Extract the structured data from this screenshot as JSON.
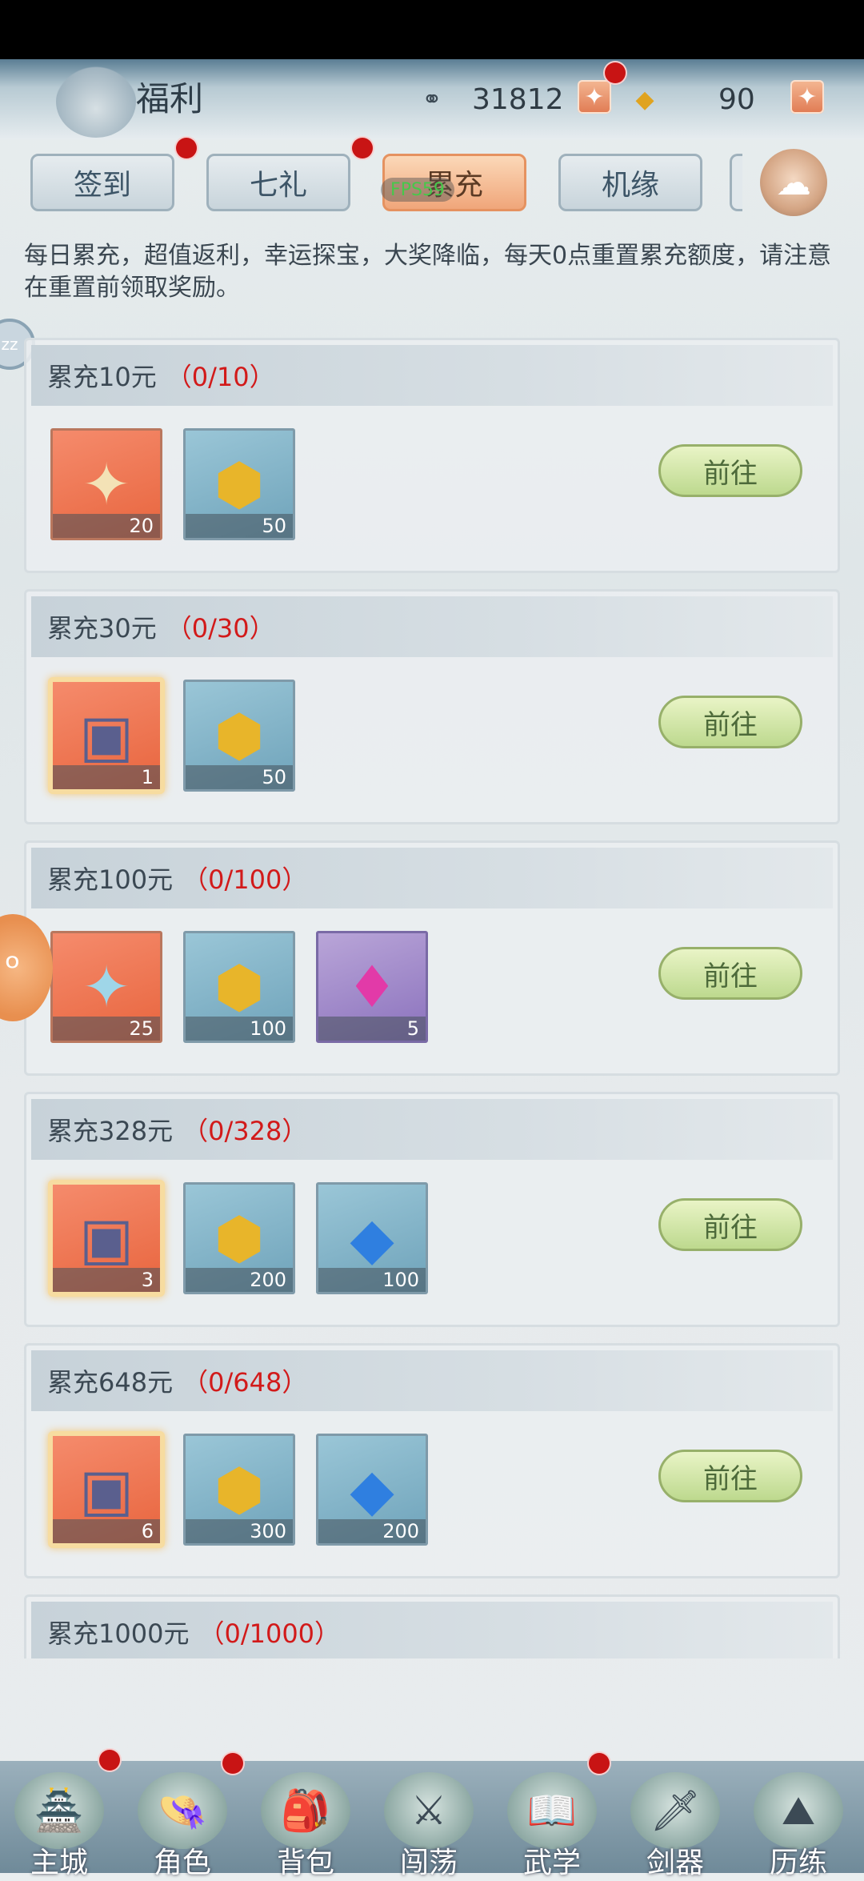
{
  "header": {
    "title": "福利",
    "coins": "31812",
    "gold": "90"
  },
  "tabs": [
    {
      "label": "签到"
    },
    {
      "label": "七礼"
    },
    {
      "label": "累充"
    },
    {
      "label": "机缘"
    }
  ],
  "overlay": {
    "fps": "FPS59"
  },
  "description": "每日累充，超值返利，幸运探宝，大奖降临，每天0点重置累充额度，请注意在重置前领取奖励。",
  "cards": [
    {
      "title": "累充10元",
      "progress": "（0/10）",
      "button": "前往",
      "items": [
        {
          "icon": "puzzle-piece-icon",
          "count": "20",
          "style": "orange"
        },
        {
          "icon": "gold-ore-icon",
          "count": "50",
          "style": "blue"
        }
      ]
    },
    {
      "title": "累充30元",
      "progress": "（0/30）",
      "button": "前往",
      "items": [
        {
          "icon": "treasure-token-icon",
          "count": "1",
          "style": "orange-glow"
        },
        {
          "icon": "gold-ore-icon",
          "count": "50",
          "style": "blue"
        }
      ]
    },
    {
      "title": "累充100元",
      "progress": "（0/100）",
      "button": "前往",
      "items": [
        {
          "icon": "rainbow-puzzle-icon",
          "count": "25",
          "style": "orange"
        },
        {
          "icon": "gold-ore-icon",
          "count": "100",
          "style": "blue"
        },
        {
          "icon": "magenta-gem-icon",
          "count": "5",
          "style": "purple"
        }
      ]
    },
    {
      "title": "累充328元",
      "progress": "（0/328）",
      "button": "前往",
      "items": [
        {
          "icon": "treasure-token-icon",
          "count": "3",
          "style": "orange-glow"
        },
        {
          "icon": "gold-ore-icon",
          "count": "200",
          "style": "blue"
        },
        {
          "icon": "blue-crystal-icon",
          "count": "100",
          "style": "blue"
        }
      ]
    },
    {
      "title": "累充648元",
      "progress": "（0/648）",
      "button": "前往",
      "items": [
        {
          "icon": "treasure-token-icon",
          "count": "6",
          "style": "orange-glow"
        },
        {
          "icon": "gold-ore-icon",
          "count": "300",
          "style": "blue"
        },
        {
          "icon": "blue-crystal-icon",
          "count": "200",
          "style": "blue"
        }
      ]
    },
    {
      "title": "累充1000元",
      "progress": "（0/1000）"
    }
  ],
  "bottom_nav": [
    {
      "label": "主城",
      "icon": "city-icon"
    },
    {
      "label": "角色",
      "icon": "character-icon"
    },
    {
      "label": "背包",
      "icon": "backpack-icon"
    },
    {
      "label": "闯荡",
      "icon": "crossed-swords-icon"
    },
    {
      "label": "武学",
      "icon": "martial-book-icon"
    },
    {
      "label": "剑器",
      "icon": "sword-icon"
    },
    {
      "label": "历练",
      "icon": "mountain-icon"
    }
  ]
}
